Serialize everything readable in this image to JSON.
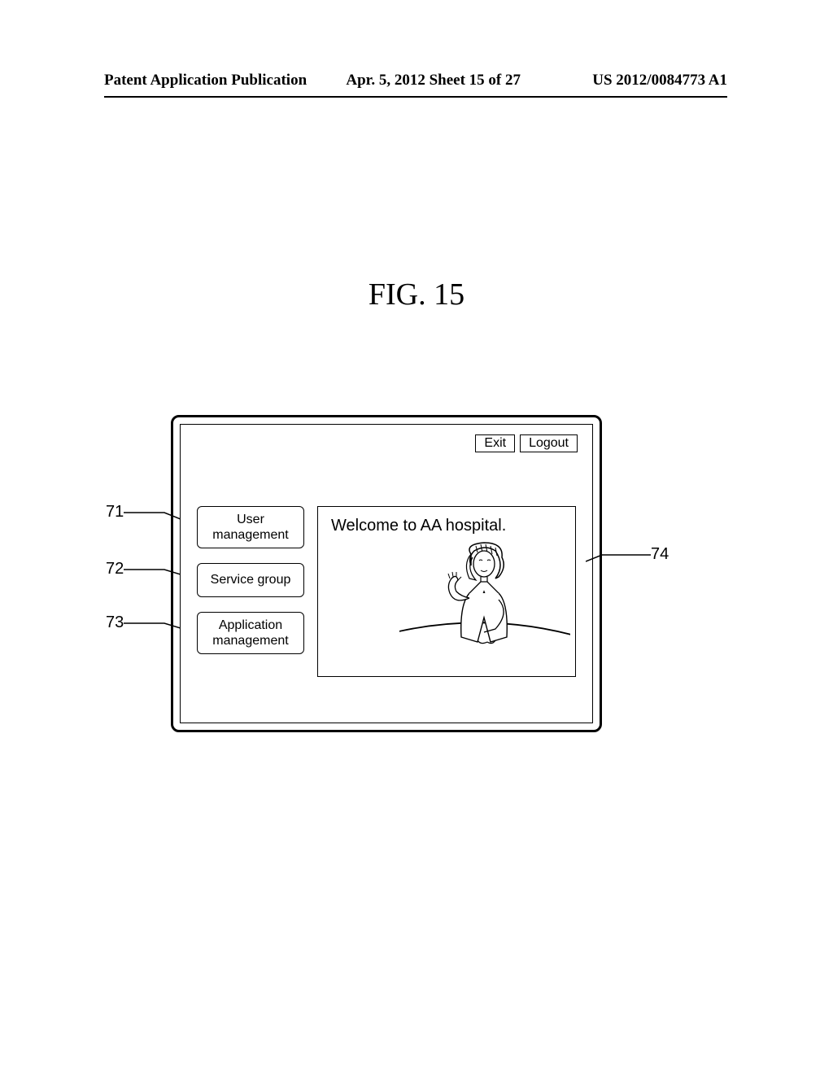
{
  "header": {
    "left": "Patent Application Publication",
    "center": "Apr. 5, 2012  Sheet 15 of 27",
    "right": "US 2012/0084773 A1"
  },
  "figure": {
    "label": "FIG. 15"
  },
  "toolbar": {
    "exit": "Exit",
    "logout": "Logout"
  },
  "menu": {
    "items": [
      {
        "label": "User\nmanagement"
      },
      {
        "label": "Service group"
      },
      {
        "label": "Application\nmanagement"
      }
    ]
  },
  "content": {
    "welcome": "Welcome to AA hospital."
  },
  "refs": {
    "r71": "71",
    "r72": "72",
    "r73": "73",
    "r74": "74"
  }
}
